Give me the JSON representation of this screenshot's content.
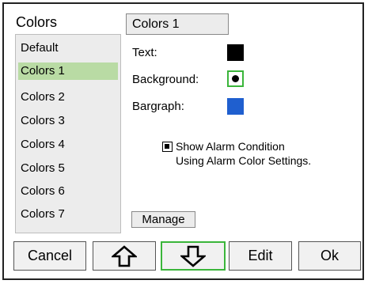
{
  "panel_title": "Colors",
  "schemes": [
    "Default",
    "Colors 1",
    "Colors 2",
    "Colors 3",
    "Colors 4",
    "Colors 5",
    "Colors 6",
    "Colors 7"
  ],
  "selected_scheme_index": 1,
  "detail": {
    "name": "Colors 1",
    "rows": [
      {
        "label": "Text:",
        "color": "#000000"
      },
      {
        "label": "Background:",
        "color": "#ffffff"
      },
      {
        "label": "Bargraph:",
        "color": "#1f5fcf"
      }
    ],
    "alarm": {
      "checked": true,
      "line1": "Show Alarm Condition",
      "line2": "Using Alarm Color Settings."
    },
    "manage_label": "Manage"
  },
  "buttons": {
    "cancel": "Cancel",
    "up_icon": "up-arrow",
    "down_icon": "down-arrow",
    "edit": "Edit",
    "ok": "Ok"
  },
  "colors": {
    "selection": "#b9dba4",
    "focus": "#3ab53a",
    "panel": "#ececec"
  }
}
